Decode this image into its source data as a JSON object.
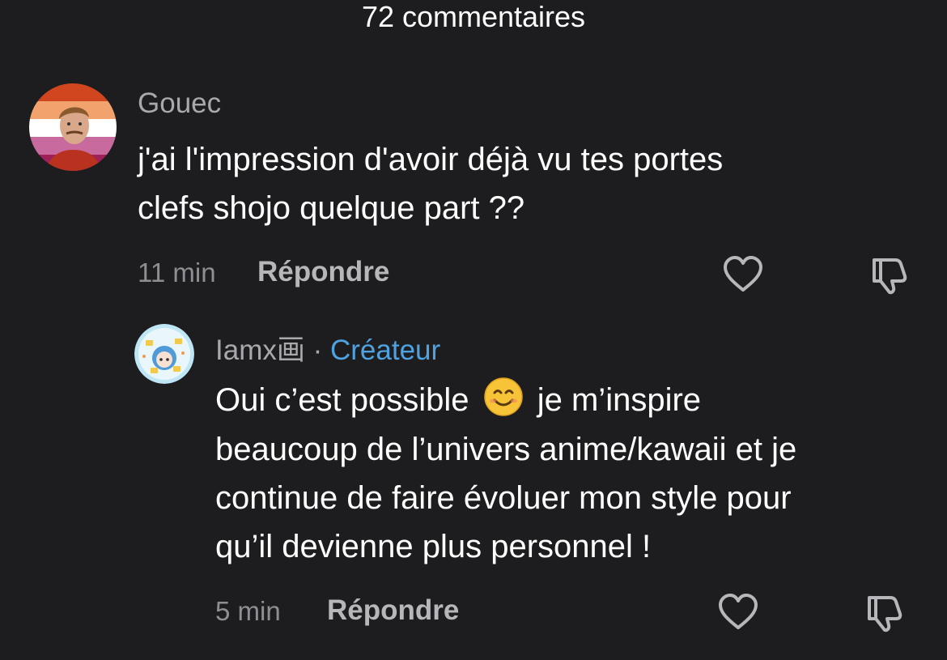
{
  "header": {
    "title": "72 commentaires"
  },
  "comments": [
    {
      "username": "Gouec",
      "text_lines": [
        "j'ai l'impression d'avoir déjà vu tes portes",
        "clefs shojo quelque part ??"
      ],
      "time": "11 min",
      "reply_label": "Répondre",
      "avatar_icon": "pride-flag-portrait-avatar"
    }
  ],
  "reply": {
    "username": "Iamx画",
    "separator": "·",
    "creator_label": "Créateur",
    "text_line1_part1": "Oui c’est possible",
    "text_line1_part2": "je m’inspire",
    "text_lines_rest": [
      "beaucoup de l’univers anime/kawaii et je",
      "continue de faire évoluer mon style pour",
      "qu’il devienne plus personnel !"
    ],
    "emoji": "smiling-face-emoji",
    "time": "5 min",
    "reply_label": "Répondre",
    "avatar_icon": "anime-character-avatar"
  },
  "icons": {
    "like": "heart-icon",
    "dislike": "thumbs-down-icon"
  },
  "colors": {
    "background": "#1d1d1f",
    "creator": "#4ea2e0",
    "muted": "#8e8e93"
  }
}
